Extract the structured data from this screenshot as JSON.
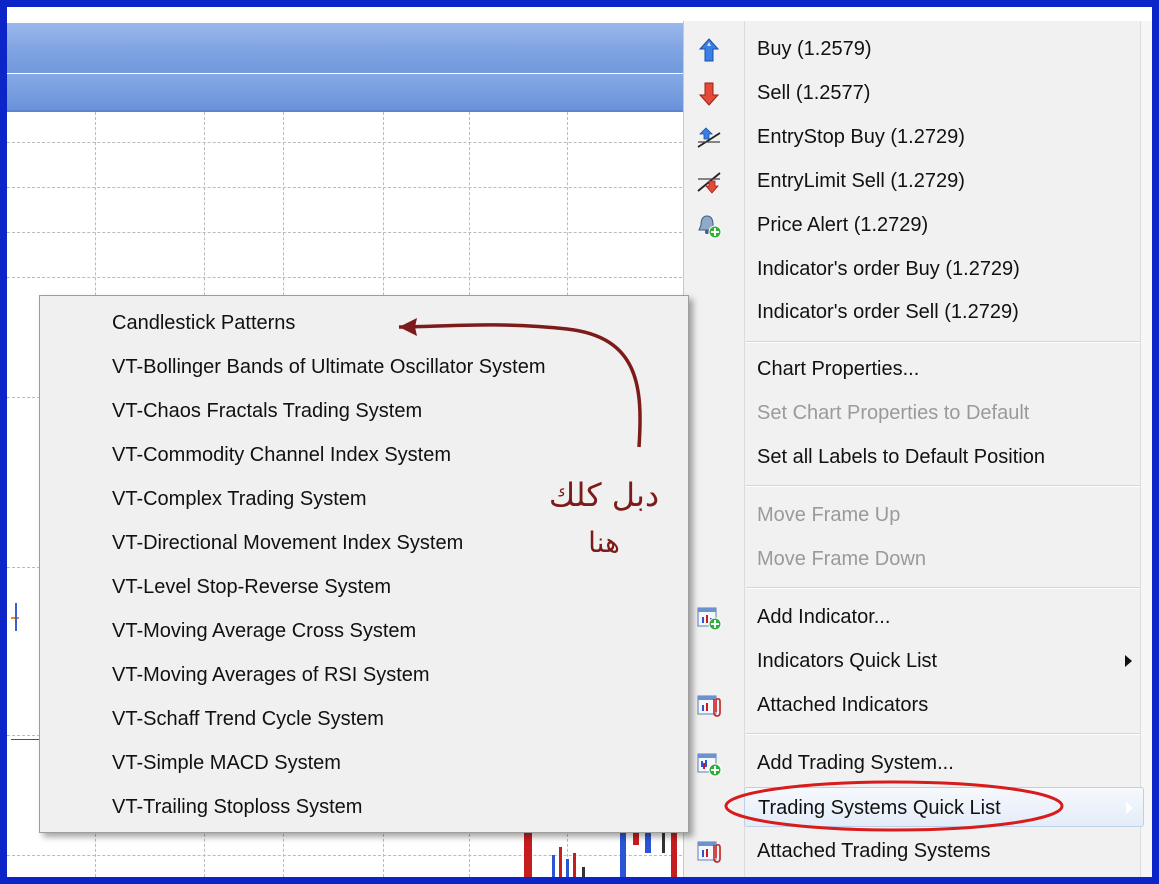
{
  "menu": {
    "items": [
      {
        "label": "Buy (1.2579)",
        "icon": "buy-arrow-up-icon"
      },
      {
        "label": "Sell (1.2577)",
        "icon": "sell-arrow-down-icon"
      },
      {
        "label": "EntryStop Buy (1.2729)",
        "icon": "entry-stop-buy-icon"
      },
      {
        "label": "EntryLimit Sell (1.2729)",
        "icon": "entry-limit-sell-icon"
      },
      {
        "label": "Price Alert (1.2729)",
        "icon": "price-alert-bell-icon"
      },
      {
        "label": "Indicator's order Buy (1.2729)"
      },
      {
        "label": "Indicator's order Sell (1.2729)"
      },
      {
        "label": "Chart Properties..."
      },
      {
        "label": "Set Chart Properties to Default",
        "disabled": true
      },
      {
        "label": "Set all Labels to Default Position"
      },
      {
        "label": "Move Frame Up",
        "disabled": true
      },
      {
        "label": "Move Frame Down",
        "disabled": true
      },
      {
        "label": "Add Indicator...",
        "icon": "add-indicator-icon"
      },
      {
        "label": "Indicators Quick List",
        "submenu": true
      },
      {
        "label": "Attached Indicators",
        "icon": "attached-indicators-icon"
      },
      {
        "label": "Add Trading System...",
        "icon": "add-trading-system-icon"
      },
      {
        "label": "Trading Systems Quick List",
        "submenu": true,
        "highlighted": true
      },
      {
        "label": "Attached Trading Systems",
        "icon": "attached-trading-systems-icon"
      }
    ]
  },
  "submenu": {
    "items": [
      "Candlestick Patterns",
      "VT-Bollinger Bands of Ultimate Oscillator System",
      "VT-Chaos Fractals Trading System",
      "VT-Commodity Channel Index System",
      "VT-Complex Trading System",
      "VT-Directional Movement Index System",
      "VT-Level Stop-Reverse System",
      "VT-Moving Average Cross System",
      "VT-Moving Averages of RSI System",
      "VT-Schaff Trend Cycle System",
      "VT-Simple MACD System",
      "VT-Trailing Stoploss System"
    ]
  },
  "annotation": {
    "line1": "دبل كلك",
    "line2": "هنا"
  },
  "colors": {
    "frame": "#0b25c9",
    "annotation": "#7d1b1b",
    "highlight_circle": "#d81b1b"
  }
}
